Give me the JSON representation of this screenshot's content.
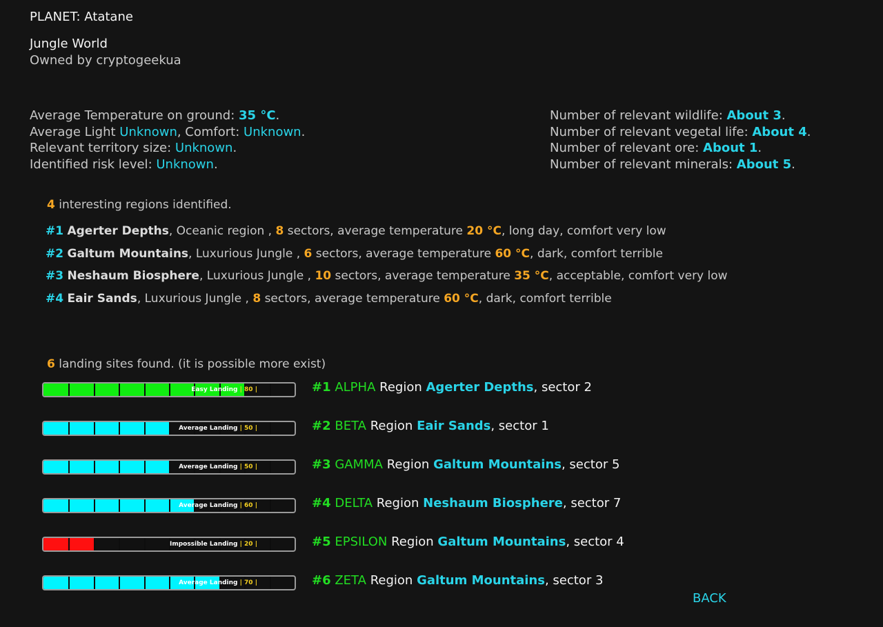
{
  "planet": {
    "label": "PLANET:",
    "name": "Atatane",
    "type": "Jungle World",
    "owner": "Owned by cryptogeekua"
  },
  "stats_left": {
    "temp_label": "Average Temperature on ground:",
    "temp_value": "35 °C",
    "light_label": "Average Light",
    "light_value": "Unknown",
    "comfort_label": ", Comfort:",
    "comfort_value": "Unknown",
    "territory_label": "Relevant territory size:",
    "territory_value": "Unknown",
    "risk_label": "Identified risk level:",
    "risk_value": "Unknown"
  },
  "stats_right": {
    "wildlife_label": "Number of relevant wildlife:",
    "wildlife_value": "About 3",
    "vegetal_label": "Number of relevant vegetal life:",
    "vegetal_value": "About 4",
    "ore_label": "Number of relevant ore:",
    "ore_value": "About 1",
    "minerals_label": "Number of relevant minerals:",
    "minerals_value": "About 5"
  },
  "regions": {
    "count": "4",
    "count_text": "interesting regions identified.",
    "items": [
      {
        "num": "#1",
        "name": "Agerter Depths",
        "type": ", Oceanic region ,",
        "sectors": "8",
        "mid": "sectors, average temperature",
        "temp": "20 °C",
        "tail": ", long day, comfort very low"
      },
      {
        "num": "#2",
        "name": "Galtum Mountains",
        "type": ", Luxurious Jungle ,",
        "sectors": "6",
        "mid": "sectors, average temperature",
        "temp": "60 °C",
        "tail": ", dark, comfort terrible"
      },
      {
        "num": "#3",
        "name": "Neshaum Biosphere",
        "type": ", Luxurious Jungle ,",
        "sectors": "10",
        "mid": "sectors, average temperature",
        "temp": "35 °C",
        "tail": ", acceptable, comfort very low"
      },
      {
        "num": "#4",
        "name": "Eair Sands",
        "type": ", Luxurious Jungle ,",
        "sectors": "8",
        "mid": "sectors, average temperature",
        "temp": "60 °C",
        "tail": ", dark, comfort terrible"
      }
    ]
  },
  "landing": {
    "count": "6",
    "count_text": "landing sites found. (it is possible more exist)",
    "region_word": "Region",
    "sites": [
      {
        "num": "#1",
        "code": "ALPHA",
        "region": "Agerter Depths",
        "sector": ", sector 2",
        "quality": "Easy Landing",
        "score_text": "| 80 |",
        "score": 80,
        "color": "#11ee11"
      },
      {
        "num": "#2",
        "code": "BETA",
        "region": "Eair Sands",
        "sector": ", sector 1",
        "quality": "Average Landing",
        "score_text": "| 50 |",
        "score": 50,
        "color": "#00f4ff"
      },
      {
        "num": "#3",
        "code": "GAMMA",
        "region": "Galtum Mountains",
        "sector": ", sector 5",
        "quality": "Average Landing",
        "score_text": "| 50 |",
        "score": 50,
        "color": "#00f4ff"
      },
      {
        "num": "#4",
        "code": "DELTA",
        "region": "Neshaum Biosphere",
        "sector": ", sector 7",
        "quality": "Average Landing",
        "score_text": "| 60 |",
        "score": 60,
        "color": "#00f4ff"
      },
      {
        "num": "#5",
        "code": "EPSILON",
        "region": "Galtum Mountains",
        "sector": ", sector 4",
        "quality": "Impossible Landing",
        "score_text": "| 20 |",
        "score": 20,
        "color": "#ff1010"
      },
      {
        "num": "#6",
        "code": "ZETA",
        "region": "Galtum Mountains",
        "sector": ", sector 3",
        "quality": "Average Landing",
        "score_text": "| 70 |",
        "score": 70,
        "color": "#00f4ff"
      }
    ]
  },
  "back_label": "BACK"
}
